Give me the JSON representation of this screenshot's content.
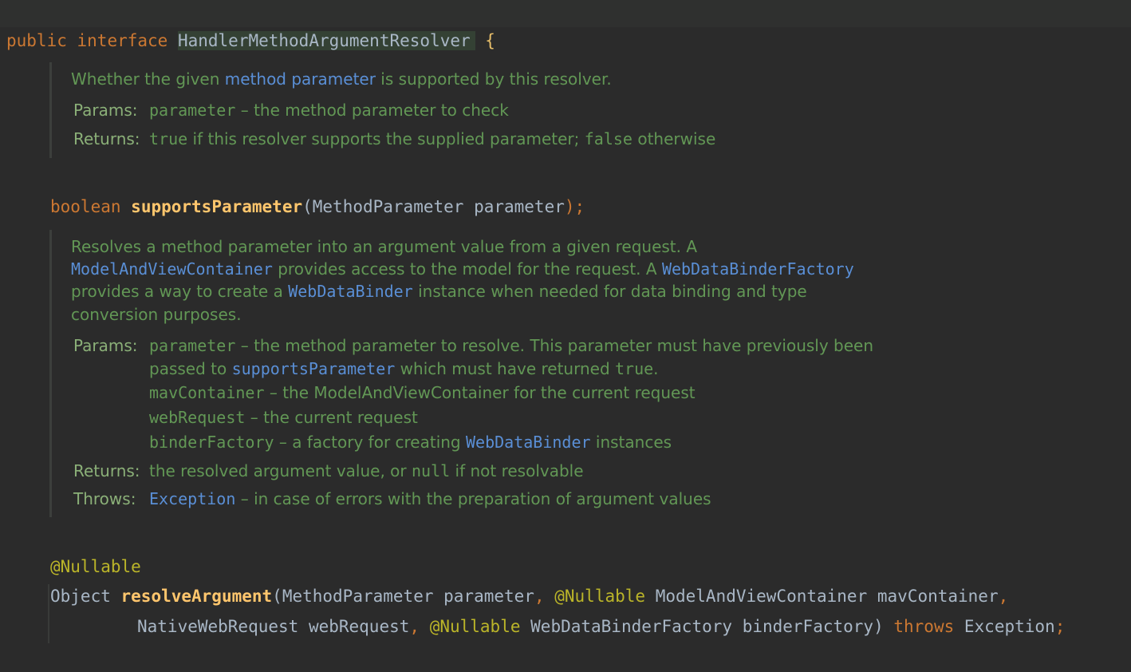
{
  "header": {
    "kw_public": "public",
    "kw_interface": "interface",
    "class_name": "HandlerMethodArgumentResolver",
    "open_brace": "{"
  },
  "doc1": {
    "summary_pre": "Whether the given ",
    "summary_link": "method parameter",
    "summary_post": " is supported by this resolver.",
    "params_label": "Params:",
    "param_name": "parameter",
    "param_desc": " – the method parameter to check",
    "returns_label": "Returns:",
    "returns_code1": "true",
    "returns_mid": " if this resolver supports the supplied parameter; ",
    "returns_code2": "false",
    "returns_post": " otherwise"
  },
  "method1": {
    "return_type": "boolean",
    "name": "supportsParameter",
    "open_paren": "(",
    "param_type": "MethodParameter",
    "param_name": "parameter",
    "close": ");"
  },
  "doc2": {
    "line1": "Resolves a method parameter into an argument value from a given request. A",
    "line2_link1": "ModelAndViewContainer",
    "line2_mid": " provides access to the model for the request. A ",
    "line2_link2": "WebDataBinderFactory",
    "line3_pre": "provides a way to create a ",
    "line3_link": "WebDataBinder",
    "line3_post": " instance when needed for data binding and type",
    "line4": "conversion purposes.",
    "params_label": "Params:",
    "p1_name": "parameter",
    "p1_desc": " – the method parameter to resolve. This parameter must have previously been",
    "p1_cont_pre": "passed to ",
    "p1_cont_link": "supportsParameter",
    "p1_cont_mid": " which must have returned ",
    "p1_cont_code": "true",
    "p1_cont_post": ".",
    "p2_name": "mavContainer",
    "p2_desc": " – the ModelAndViewContainer for the current request",
    "p3_name": "webRequest",
    "p3_desc": " – the current request",
    "p4_name": "binderFactory",
    "p4_desc_pre": " – a factory for creating ",
    "p4_link": "WebDataBinder",
    "p4_desc_post": " instances",
    "returns_label": "Returns:",
    "returns_pre": "the resolved argument value, or ",
    "returns_code": "null",
    "returns_post": " if not resolvable",
    "throws_label": "Throws:",
    "throws_link": "Exception",
    "throws_desc": " – in case of errors with the preparation of argument values"
  },
  "method2": {
    "annotation": "@Nullable",
    "return_type": "Object",
    "name": "resolveArgument",
    "open_paren": "(",
    "p1_type": "MethodParameter",
    "p1_name": "parameter",
    "comma": ",",
    "p2_ann": "@Nullable",
    "p2_type": "ModelAndViewContainer",
    "p2_name": "mavContainer",
    "p3_type": "NativeWebRequest",
    "p3_name": "webRequest",
    "p4_ann": "@Nullable",
    "p4_type": "WebDataBinderFactory",
    "p4_name": "binderFactory",
    "close_paren": ")",
    "throws_kw": "throws",
    "exception": "Exception",
    "semicolon": ";"
  },
  "footer": {
    "close_brace": "}"
  },
  "colors": {
    "background": "#2b2b2b",
    "keyword": "#cc7832",
    "method_name": "#ffc66d",
    "identifier": "#a9b7c6",
    "annotation": "#bbb529",
    "doc_text": "#629755",
    "doc_link": "#5a8fd6"
  }
}
